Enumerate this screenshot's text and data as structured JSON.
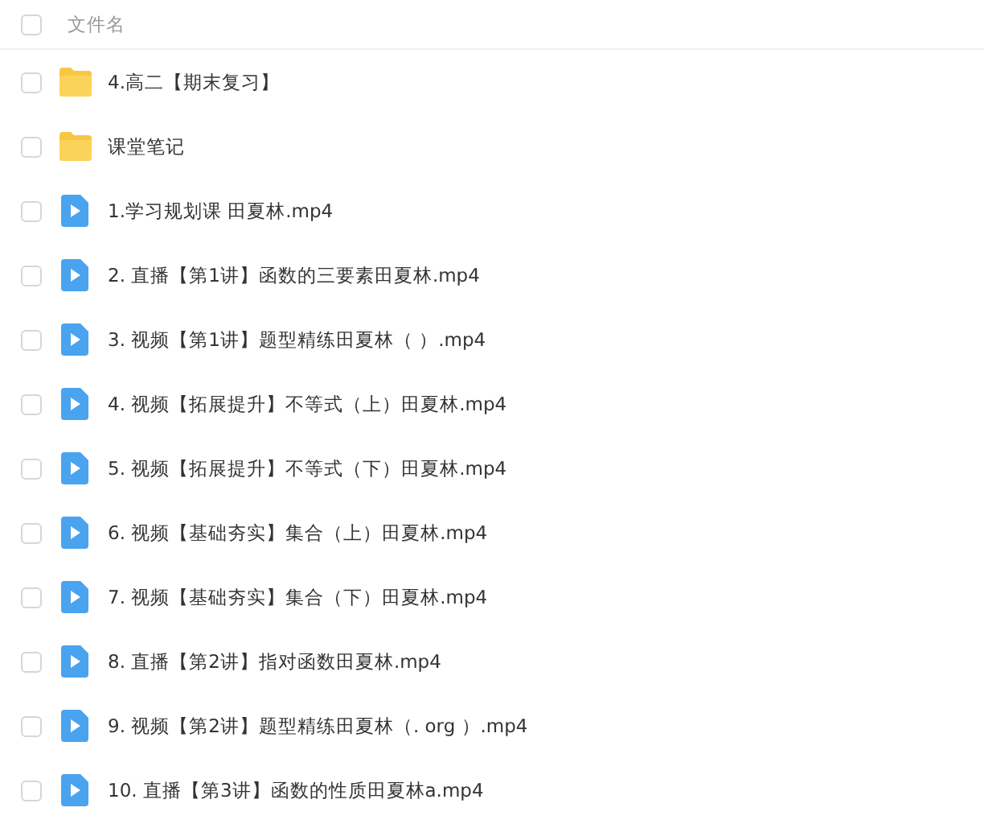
{
  "header": {
    "label": "文件名",
    "checked": false
  },
  "files": [
    {
      "kind": "folder",
      "name": "4.高二【期末复习】",
      "checked": false
    },
    {
      "kind": "folder",
      "name": "课堂笔记",
      "checked": false
    },
    {
      "kind": "video",
      "name": "1.学习规划课 田夏林.mp4",
      "checked": false
    },
    {
      "kind": "video",
      "name": "2. 直播【第1讲】函数的三要素田夏林.mp4",
      "checked": false
    },
    {
      "kind": "video",
      "name": "3. 视频【第1讲】题型精练田夏林（ ）.mp4",
      "checked": false
    },
    {
      "kind": "video",
      "name": "4. 视频【拓展提升】不等式（上）田夏林.mp4",
      "checked": false
    },
    {
      "kind": "video",
      "name": "5. 视频【拓展提升】不等式（下）田夏林.mp4",
      "checked": false
    },
    {
      "kind": "video",
      "name": "6. 视频【基础夯实】集合（上）田夏林.mp4",
      "checked": false
    },
    {
      "kind": "video",
      "name": "7. 视频【基础夯实】集合（下）田夏林.mp4",
      "checked": false
    },
    {
      "kind": "video",
      "name": "8. 直播【第2讲】指对函数田夏林.mp4",
      "checked": false
    },
    {
      "kind": "video",
      "name": "9. 视频【第2讲】题型精练田夏林（. org ）.mp4",
      "checked": false
    },
    {
      "kind": "video",
      "name": "10. 直播【第3讲】函数的性质田夏林a.mp4",
      "checked": false
    }
  ]
}
